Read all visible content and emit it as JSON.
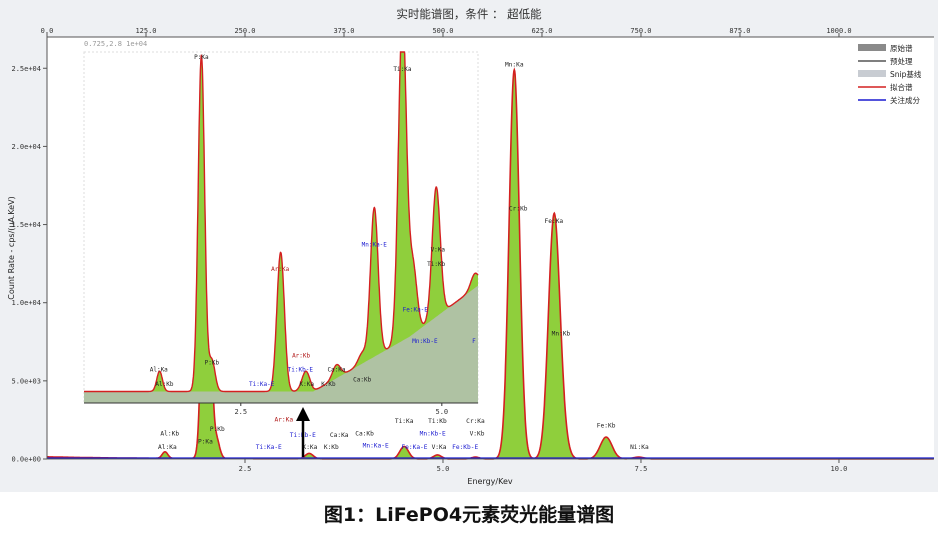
{
  "chart_data": {
    "type": "line",
    "title": "实时能谱图，条件 ： 超低能",
    "xlabel": "Energy/Kev",
    "ylabel": "Count Rate - cps/(uA.KeV)",
    "x_range": [
      0,
      11.2
    ],
    "y_range": [
      0,
      27000
    ],
    "x_ticks": [
      "2.5",
      "5.0",
      "7.5",
      "10.0"
    ],
    "x_tick_values": [
      2.5,
      5.0,
      7.5,
      10.0
    ],
    "y_ticks": [
      "0.0e+00",
      "5.0e+03",
      "1.0e+04",
      "1.5e+04",
      "2.0e+04",
      "2.5e+04"
    ],
    "y_tick_values": [
      0,
      5000,
      10000,
      15000,
      20000,
      25000
    ],
    "top_ticks": [
      "0.0",
      "125.0",
      "250.0",
      "375.0",
      "500.0",
      "625.0",
      "750.0",
      "875.0",
      "1000.0"
    ],
    "top_tick_values": [
      0,
      125,
      250,
      375,
      500,
      625,
      750,
      875,
      1000
    ],
    "top_axis_range": [
      0,
      1120
    ],
    "coord_readout": "0.725,2.8 1e+04",
    "grid": false,
    "legend_position": "top-right",
    "legend": [
      {
        "label": "原始谱",
        "color": "#8a8a8a",
        "style": "area"
      },
      {
        "label": "预处理",
        "color": "#555555",
        "style": "line"
      },
      {
        "label": "Snip基线",
        "color": "#c8ccd2",
        "style": "area"
      },
      {
        "label": "拟合谱",
        "color": "#d42020",
        "style": "line"
      },
      {
        "label": "关注成分",
        "color": "#1a1ad0",
        "style": "line"
      }
    ],
    "peaks": [
      {
        "energy": 1.49,
        "height": 420,
        "sigma": 0.035
      },
      {
        "energy": 2.01,
        "height": 25800,
        "sigma": 0.045
      },
      {
        "energy": 2.14,
        "height": 1200,
        "sigma": 0.04
      },
      {
        "energy": 3.31,
        "height": 350,
        "sigma": 0.05
      },
      {
        "energy": 4.51,
        "height": 800,
        "sigma": 0.055
      },
      {
        "energy": 4.93,
        "height": 260,
        "sigma": 0.05
      },
      {
        "energy": 5.41,
        "height": 120,
        "sigma": 0.05
      },
      {
        "energy": 5.9,
        "height": 24900,
        "sigma": 0.065
      },
      {
        "energy": 6.4,
        "height": 14900,
        "sigma": 0.07
      },
      {
        "energy": 6.49,
        "height": 1800,
        "sigma": 0.07
      },
      {
        "energy": 7.06,
        "height": 1400,
        "sigma": 0.075
      },
      {
        "energy": 7.47,
        "height": 120,
        "sigma": 0.07
      }
    ],
    "annotations": [
      {
        "text": "Al:Kb",
        "x": 1.55,
        "y": 1500,
        "color": "#222"
      },
      {
        "text": "Al:Ka",
        "x": 1.52,
        "y": 650,
        "color": "#222"
      },
      {
        "text": "P:Kb",
        "x": 2.15,
        "y": 1800,
        "color": "#222"
      },
      {
        "text": "P:Ka",
        "x": 2.0,
        "y": 1000,
        "color": "#222"
      },
      {
        "text": "Ti:Ka-E",
        "x": 2.8,
        "y": 650,
        "color": "#1a1ad0"
      },
      {
        "text": "Ar:Ka",
        "x": 2.99,
        "y": 2400,
        "color": "#b01818"
      },
      {
        "text": "Ti:Kb-E",
        "x": 3.23,
        "y": 1400,
        "color": "#1a1ad0"
      },
      {
        "text": "K:Ka",
        "x": 3.32,
        "y": 650,
        "color": "#222"
      },
      {
        "text": "Ca:Ka",
        "x": 3.69,
        "y": 1400,
        "color": "#222"
      },
      {
        "text": "K:Kb",
        "x": 3.59,
        "y": 650,
        "color": "#222"
      },
      {
        "text": "Ca:Kb",
        "x": 4.01,
        "y": 1500,
        "color": "#222"
      },
      {
        "text": "Mn:Ka-E",
        "x": 4.15,
        "y": 750,
        "color": "#1a1ad0"
      },
      {
        "text": "Ti:Ka",
        "x": 4.51,
        "y": 2300,
        "color": "#222"
      },
      {
        "text": "Fe:Ka-E",
        "x": 4.64,
        "y": 650,
        "color": "#1a1ad0"
      },
      {
        "text": "Ti:Kb",
        "x": 4.93,
        "y": 2300,
        "color": "#222"
      },
      {
        "text": "Mn:Kb-E",
        "x": 4.87,
        "y": 1500,
        "color": "#1a1ad0"
      },
      {
        "text": "V:Ka",
        "x": 4.95,
        "y": 650,
        "color": "#222"
      },
      {
        "text": "Cr:Ka",
        "x": 5.41,
        "y": 2300,
        "color": "#222"
      },
      {
        "text": "V:Kb",
        "x": 5.43,
        "y": 1500,
        "color": "#222"
      },
      {
        "text": "Fe:Kb-E",
        "x": 5.28,
        "y": 650,
        "color": "#1a1ad0"
      },
      {
        "text": "Mn:Ka",
        "x": 5.9,
        "y": 25100,
        "color": "#222"
      },
      {
        "text": "Cr:Kb",
        "x": 5.95,
        "y": 15900,
        "color": "#222"
      },
      {
        "text": "Fe:Ka",
        "x": 6.4,
        "y": 15100,
        "color": "#222"
      },
      {
        "text": "Mn:Kb",
        "x": 6.49,
        "y": 7900,
        "color": "#222"
      },
      {
        "text": "Fe:Kb",
        "x": 7.06,
        "y": 2000,
        "color": "#222"
      },
      {
        "text": "Ni:Ka",
        "x": 7.48,
        "y": 650,
        "color": "#222"
      }
    ],
    "inset": {
      "x_range": [
        0.55,
        5.45
      ],
      "y_range": [
        0,
        7300
      ],
      "x_ticks": [
        "2.5",
        "5.0"
      ],
      "x_tick_values": [
        2.5,
        5.0
      ],
      "peaks": [
        {
          "energy": 1.49,
          "height": 420,
          "sigma": 0.035
        },
        {
          "energy": 2.01,
          "height": 7000,
          "sigma": 0.04
        },
        {
          "energy": 2.14,
          "height": 650,
          "sigma": 0.04
        },
        {
          "energy": 2.96,
          "height": 380,
          "sigma": 0.04
        },
        {
          "energy": 3.0,
          "height": 2650,
          "sigma": 0.045
        },
        {
          "energy": 3.31,
          "height": 420,
          "sigma": 0.05
        },
        {
          "energy": 3.69,
          "height": 280,
          "sigma": 0.05
        },
        {
          "energy": 4.01,
          "height": 220,
          "sigma": 0.05
        },
        {
          "energy": 4.16,
          "height": 3100,
          "sigma": 0.048
        },
        {
          "energy": 4.51,
          "height": 6750,
          "sigma": 0.05
        },
        {
          "energy": 4.64,
          "height": 1400,
          "sigma": 0.05
        },
        {
          "energy": 4.93,
          "height": 2700,
          "sigma": 0.05
        },
        {
          "energy": 5.41,
          "height": 300,
          "sigma": 0.05
        }
      ],
      "annotations": [
        {
          "text": "Al:Ka",
          "x": 1.48,
          "y": 650,
          "color": "#222"
        },
        {
          "text": "Al:Kb",
          "x": 1.55,
          "y": 350,
          "color": "#222"
        },
        {
          "text": "P:Ka",
          "x": 2.01,
          "y": 7150,
          "color": "#222"
        },
        {
          "text": "P:Kb",
          "x": 2.14,
          "y": 800,
          "color": "#222"
        },
        {
          "text": "Ti:Ka-E",
          "x": 2.76,
          "y": 350,
          "color": "#1a1ad0"
        },
        {
          "text": "Ar:Ka",
          "x": 2.99,
          "y": 2750,
          "color": "#b01818"
        },
        {
          "text": "Ar:Kb",
          "x": 3.25,
          "y": 950,
          "color": "#b01818"
        },
        {
          "text": "Ti:Kb-E",
          "x": 3.24,
          "y": 650,
          "color": "#1a1ad0"
        },
        {
          "text": "K:Ka",
          "x": 3.32,
          "y": 350,
          "color": "#222"
        },
        {
          "text": "Ca:Ka",
          "x": 3.69,
          "y": 650,
          "color": "#222"
        },
        {
          "text": "K:Kb",
          "x": 3.59,
          "y": 350,
          "color": "#222"
        },
        {
          "text": "Ca:Kb",
          "x": 4.01,
          "y": 450,
          "color": "#222"
        },
        {
          "text": "Mn:Ka-E",
          "x": 4.16,
          "y": 3250,
          "color": "#1a1ad0"
        },
        {
          "text": "Ti:Ka",
          "x": 4.51,
          "y": 6900,
          "color": "#222"
        },
        {
          "text": "Fe:Ka-E",
          "x": 4.67,
          "y": 1900,
          "color": "#1a1ad0"
        },
        {
          "text": "Mn:Kb-E",
          "x": 4.79,
          "y": 1250,
          "color": "#1a1ad0"
        },
        {
          "text": "V:Ka",
          "x": 4.95,
          "y": 3150,
          "color": "#222"
        },
        {
          "text": "Ti:Kb",
          "x": 4.93,
          "y": 2850,
          "color": "#222"
        },
        {
          "text": "F",
          "x": 5.4,
          "y": 1250,
          "color": "#1a1ad0"
        }
      ]
    }
  },
  "caption": "图1：LiFePO4元素荧光能量谱图",
  "colors": {
    "fill": "#8fcf3c",
    "fit": "#d42020",
    "focus": "#1a1ad0",
    "baseline_gray": "#c8ccd2",
    "plot_bg": "#ffffff",
    "frame_bg": "#eef0f3"
  }
}
